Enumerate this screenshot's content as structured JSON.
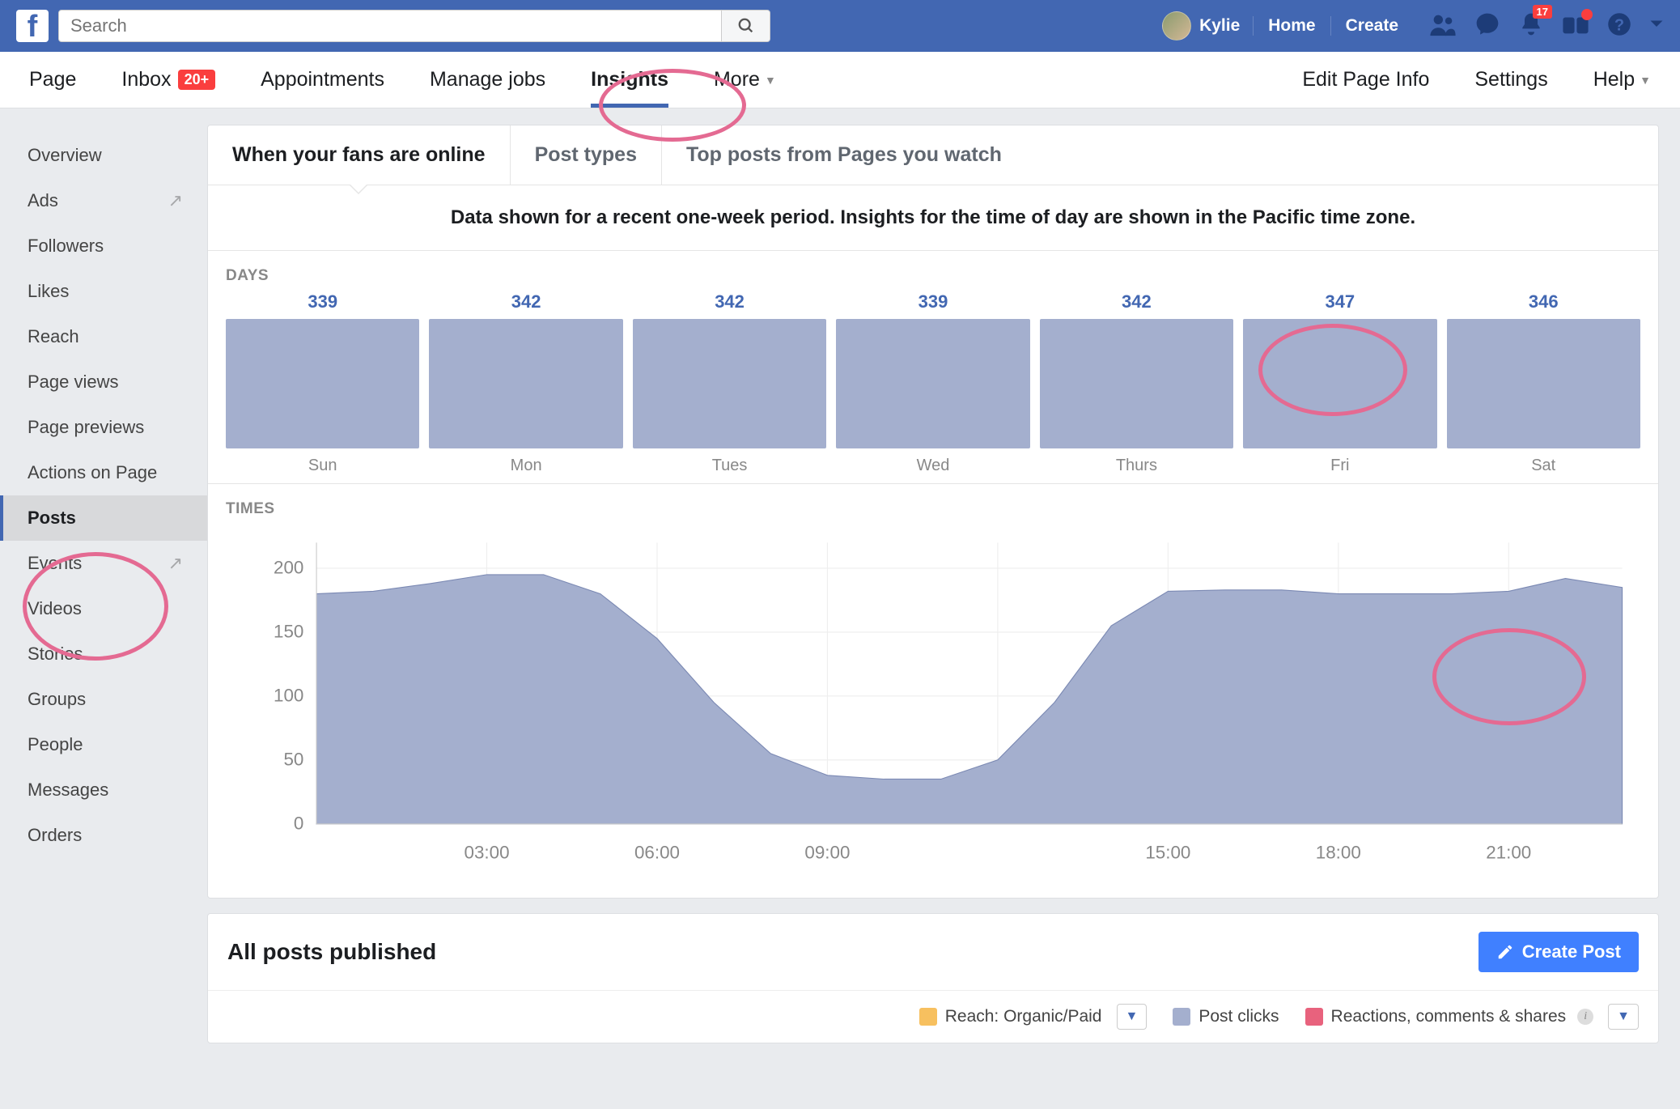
{
  "topbar": {
    "search_placeholder": "Search",
    "profile_name": "Kylie",
    "home": "Home",
    "create": "Create",
    "notif_badge": "17"
  },
  "pagenav": {
    "page": "Page",
    "inbox": "Inbox",
    "inbox_badge": "20+",
    "appointments": "Appointments",
    "manage_jobs": "Manage jobs",
    "insights": "Insights",
    "more": "More",
    "edit_page_info": "Edit Page Info",
    "settings": "Settings",
    "help": "Help"
  },
  "sidebar": {
    "overview": "Overview",
    "ads": "Ads",
    "followers": "Followers",
    "likes": "Likes",
    "reach": "Reach",
    "page_views": "Page views",
    "page_previews": "Page previews",
    "actions": "Actions on Page",
    "posts": "Posts",
    "events": "Events",
    "videos": "Videos",
    "stories": "Stories",
    "groups": "Groups",
    "people": "People",
    "messages": "Messages",
    "orders": "Orders"
  },
  "tabs": {
    "fans_online": "When your fans are online",
    "post_types": "Post types",
    "top_posts": "Top posts from Pages you watch"
  },
  "info_strip": "Data shown for a recent one-week period. Insights for the time of day are shown in the Pacific time zone.",
  "days_label": "DAYS",
  "times_label": "TIMES",
  "allposts": {
    "title": "All posts published",
    "create_label": "Create Post"
  },
  "legend": {
    "reach": "Reach: Organic/Paid",
    "clicks": "Post clicks",
    "reactions": "Reactions, comments & shares"
  },
  "chart_data": [
    {
      "type": "bar",
      "title": "DAYS",
      "categories": [
        "Sun",
        "Mon",
        "Tues",
        "Wed",
        "Thurs",
        "Fri",
        "Sat"
      ],
      "values": [
        339,
        342,
        342,
        339,
        342,
        347,
        346
      ]
    },
    {
      "type": "area",
      "title": "TIMES",
      "xlabel": "",
      "ylabel": "",
      "ylim": [
        0,
        220
      ],
      "x_ticks": [
        "03:00",
        "06:00",
        "09:00",
        "15:00",
        "18:00",
        "21:00"
      ],
      "x": [
        0,
        1,
        2,
        3,
        4,
        5,
        6,
        7,
        8,
        9,
        10,
        11,
        12,
        13,
        14,
        15,
        16,
        17,
        18,
        19,
        20,
        21,
        22,
        23
      ],
      "values": [
        180,
        182,
        188,
        195,
        195,
        180,
        145,
        95,
        55,
        38,
        35,
        35,
        50,
        95,
        155,
        182,
        183,
        183,
        180,
        180,
        180,
        182,
        192,
        185
      ]
    }
  ]
}
